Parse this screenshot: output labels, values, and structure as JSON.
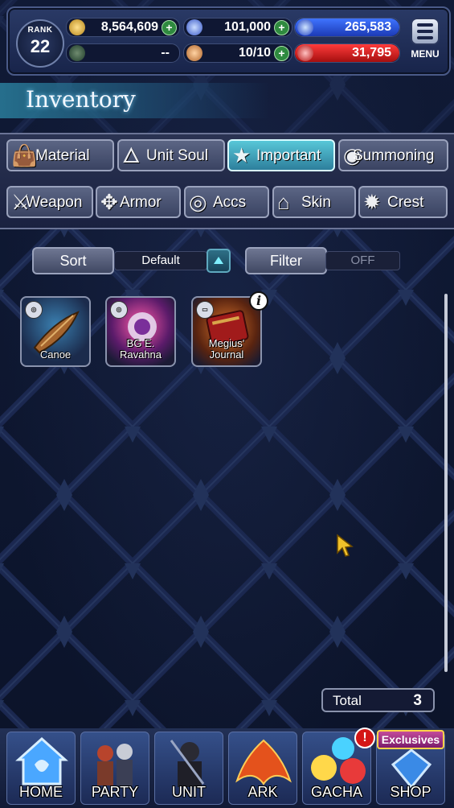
{
  "header": {
    "rank_label": "RANK",
    "rank_value": "22",
    "gil": "8,564,609",
    "visiore": "101,000",
    "lapis": "265,583",
    "guild_value": "--",
    "stamina": "10/10",
    "energy": "31,795",
    "menu_label": "MENU"
  },
  "title": "Inventory",
  "tabs_row1": [
    {
      "label": "Material",
      "icon": "material-bag-icon",
      "active": false
    },
    {
      "label": "Unit Soul",
      "icon": "unit-soul-icon",
      "active": false
    },
    {
      "label": "Important",
      "icon": "star-icon",
      "active": true
    },
    {
      "label": "Summoning",
      "icon": "summoning-icon",
      "active": false
    }
  ],
  "tabs_row2": [
    {
      "label": "Weapon",
      "icon": "sword-icon"
    },
    {
      "label": "Armor",
      "icon": "armor-icon"
    },
    {
      "label": "Accs",
      "icon": "accessory-icon"
    },
    {
      "label": "Skin",
      "icon": "hanger-icon"
    },
    {
      "label": "Crest",
      "icon": "crest-icon"
    }
  ],
  "sort": {
    "label": "Sort",
    "value": "Default"
  },
  "filter": {
    "label": "Filter",
    "value": "OFF"
  },
  "items": [
    {
      "label": "Canoe"
    },
    {
      "label": "BG E. Ravahna"
    },
    {
      "label": "Megius' Journal"
    }
  ],
  "total": {
    "label": "Total",
    "value": "3"
  },
  "nav": [
    {
      "label": "HOME"
    },
    {
      "label": "PARTY"
    },
    {
      "label": "UNIT"
    },
    {
      "label": "ARK"
    },
    {
      "label": "GACHA"
    },
    {
      "label": "SHOP"
    }
  ],
  "exclusives_label": "Exclusives",
  "alert_glyph": "!",
  "info_glyph": "i",
  "colors": {
    "accent_cyan": "#58c7d8",
    "energy_red": "#ff3b3b",
    "lapis_blue": "#3f74ff",
    "plus_green": "#2f8a3f"
  }
}
